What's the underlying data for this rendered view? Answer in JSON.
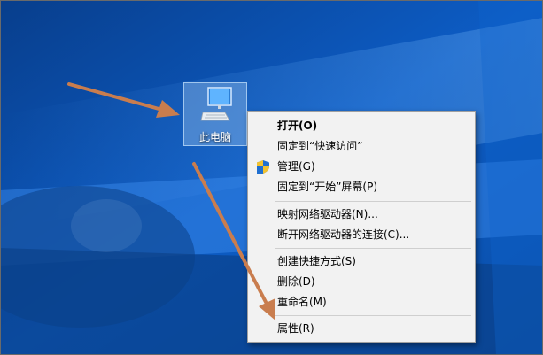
{
  "desktop": {
    "icon": {
      "label": "此电脑",
      "icon_name": "computer-monitor-icon"
    }
  },
  "context_menu": {
    "items": [
      {
        "label": "打开(O)",
        "bold": true
      },
      {
        "label": "固定到“快速访问”"
      },
      {
        "label": "管理(G)",
        "icon": "uac-shield-icon"
      },
      {
        "label": "固定到“开始”屏幕(P)"
      },
      {
        "label": "映射网络驱动器(N)..."
      },
      {
        "label": "断开网络驱动器的连接(C)..."
      },
      {
        "label": "创建快捷方式(S)"
      },
      {
        "label": "删除(D)"
      },
      {
        "label": "重命名(M)"
      },
      {
        "label": "属性(R)"
      }
    ]
  },
  "colors": {
    "wallpaper_base": "#0a4fa6",
    "menu_background": "#f2f2f2",
    "annotation_arrow": "#c97d4e"
  }
}
